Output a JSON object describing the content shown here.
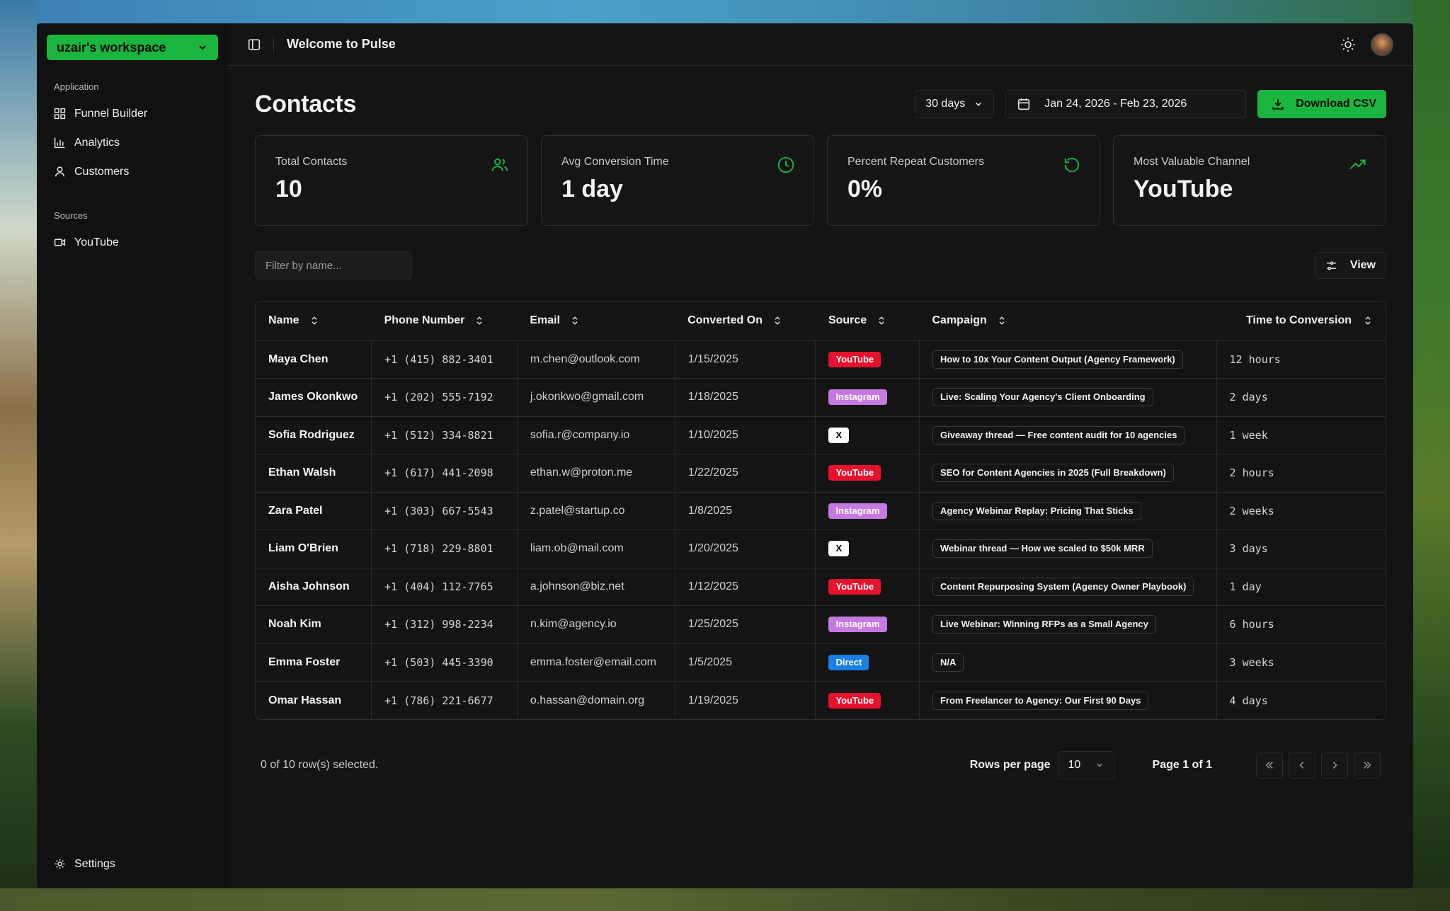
{
  "sidebar": {
    "workspace": "uzair's workspace",
    "application_label": "Application",
    "items": [
      {
        "label": "Funnel Builder",
        "icon": "grid-icon"
      },
      {
        "label": "Analytics",
        "icon": "bar-chart-icon"
      },
      {
        "label": "Customers",
        "icon": "user-icon"
      }
    ],
    "sources_label": "Sources",
    "sources": [
      {
        "label": "YouTube",
        "icon": "video-icon"
      }
    ],
    "settings": "Settings"
  },
  "topbar": {
    "title": "Welcome to Pulse"
  },
  "page": {
    "title": "Contacts",
    "range": "30 days",
    "date_range": "Jan 24, 2026 - Feb 23, 2026",
    "download": "Download CSV"
  },
  "stats": [
    {
      "label": "Total Contacts",
      "value": "10",
      "icon": "users-icon"
    },
    {
      "label": "Avg Conversion Time",
      "value": "1 day",
      "icon": "clock-icon"
    },
    {
      "label": "Percent Repeat Customers",
      "value": "0%",
      "icon": "refresh-icon"
    },
    {
      "label": "Most Valuable Channel",
      "value": "YouTube",
      "icon": "trending-up-icon"
    }
  ],
  "filter": {
    "placeholder": "Filter by name..."
  },
  "view_label": "View",
  "table": {
    "columns": [
      "Name",
      "Phone Number",
      "Email",
      "Converted On",
      "Source",
      "Campaign",
      "Time to Conversion"
    ],
    "rows": [
      {
        "name": "Maya Chen",
        "phone": "+1 (415) 882-3401",
        "email": "m.chen@outlook.com",
        "date": "1/15/2025",
        "source": "YouTube",
        "campaign": "How to 10x Your Content Output (Agency Framework)",
        "time": "12 hours"
      },
      {
        "name": "James Okonkwo",
        "phone": "+1 (202) 555-7192",
        "email": "j.okonkwo@gmail.com",
        "date": "1/18/2025",
        "source": "Instagram",
        "campaign": "Live: Scaling Your Agency's Client Onboarding",
        "time": "2 days"
      },
      {
        "name": "Sofia Rodriguez",
        "phone": "+1 (512) 334-8821",
        "email": "sofia.r@company.io",
        "date": "1/10/2025",
        "source": "X",
        "campaign": "Giveaway thread — Free content audit for 10 agencies",
        "time": "1 week"
      },
      {
        "name": "Ethan Walsh",
        "phone": "+1 (617) 441-2098",
        "email": "ethan.w@proton.me",
        "date": "1/22/2025",
        "source": "YouTube",
        "campaign": "SEO for Content Agencies in 2025 (Full Breakdown)",
        "time": "2 hours"
      },
      {
        "name": "Zara Patel",
        "phone": "+1 (303) 667-5543",
        "email": "z.patel@startup.co",
        "date": "1/8/2025",
        "source": "Instagram",
        "campaign": "Agency Webinar Replay: Pricing That Sticks",
        "time": "2 weeks"
      },
      {
        "name": "Liam O'Brien",
        "phone": "+1 (718) 229-8801",
        "email": "liam.ob@mail.com",
        "date": "1/20/2025",
        "source": "X",
        "campaign": "Webinar thread — How we scaled to $50k MRR",
        "time": "3 days"
      },
      {
        "name": "Aisha Johnson",
        "phone": "+1 (404) 112-7765",
        "email": "a.johnson@biz.net",
        "date": "1/12/2025",
        "source": "YouTube",
        "campaign": "Content Repurposing System (Agency Owner Playbook)",
        "time": "1 day"
      },
      {
        "name": "Noah Kim",
        "phone": "+1 (312) 998-2234",
        "email": "n.kim@agency.io",
        "date": "1/25/2025",
        "source": "Instagram",
        "campaign": "Live Webinar: Winning RFPs as a Small Agency",
        "time": "6 hours"
      },
      {
        "name": "Emma Foster",
        "phone": "+1 (503) 445-3390",
        "email": "emma.foster@email.com",
        "date": "1/5/2025",
        "source": "Direct",
        "campaign": "N/A",
        "time": "3 weeks"
      },
      {
        "name": "Omar Hassan",
        "phone": "+1 (786) 221-6677",
        "email": "o.hassan@domain.org",
        "date": "1/19/2025",
        "source": "YouTube",
        "campaign": "From Freelancer to Agency: Our First 90 Days",
        "time": "4 days"
      }
    ]
  },
  "source_colors": {
    "YouTube": {
      "bg": "#e8112d",
      "fg": "#ffffff"
    },
    "Instagram": {
      "bg": "#c47ae0",
      "fg": "#ffffff"
    },
    "X": {
      "bg": "#ffffff",
      "fg": "#000000"
    },
    "Direct": {
      "bg": "#1a7fe6",
      "fg": "#ffffff"
    }
  },
  "footer": {
    "selected": "0 of 10 row(s) selected.",
    "rows_per_page_label": "Rows per page",
    "rows_per_page": "10",
    "page": "Page 1 of 1"
  },
  "accent": "#19b53e"
}
